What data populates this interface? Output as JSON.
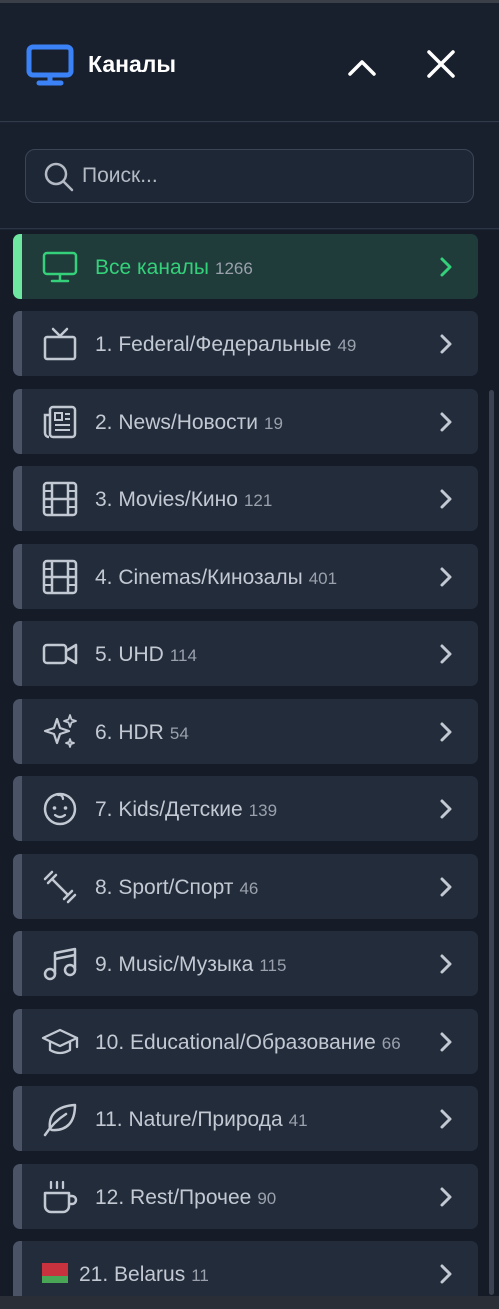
{
  "header": {
    "title": "Каналы",
    "icon": "tv-monitor-icon",
    "collapse_icon": "chevron-up-icon",
    "close_icon": "close-icon"
  },
  "search": {
    "placeholder": "Поиск...",
    "value": ""
  },
  "colors": {
    "accent_green": "#34d17a",
    "active_bar": "#6ee7a0",
    "title_blue": "#3b82f6"
  },
  "categories": [
    {
      "label": "Все каналы",
      "count": "1266",
      "icon": "tv-monitor-icon",
      "active": true
    },
    {
      "label": "1. Federal/Федеральные",
      "count": "49",
      "icon": "tv-antenna-icon"
    },
    {
      "label": "2. News/Новости",
      "count": "19",
      "icon": "newspaper-icon"
    },
    {
      "label": "3. Movies/Кино",
      "count": "121",
      "icon": "film-icon"
    },
    {
      "label": "4. Cinemas/Кинозалы",
      "count": "401",
      "icon": "film-icon"
    },
    {
      "label": "5. UHD",
      "count": "114",
      "icon": "video-camera-icon"
    },
    {
      "label": "6. HDR",
      "count": "54",
      "icon": "sparkles-icon"
    },
    {
      "label": "7. Kids/Детские",
      "count": "139",
      "icon": "baby-face-icon"
    },
    {
      "label": "8. Sport/Спорт",
      "count": "46",
      "icon": "dumbbell-icon"
    },
    {
      "label": "9. Music/Музыка",
      "count": "115",
      "icon": "music-note-icon"
    },
    {
      "label": "10. Educational/Образование",
      "count": "66",
      "icon": "graduation-cap-icon"
    },
    {
      "label": "11. Nature/Природа",
      "count": "41",
      "icon": "leaf-icon"
    },
    {
      "label": "12. Rest/Прочее",
      "count": "90",
      "icon": "coffee-cup-icon"
    },
    {
      "label": "21. Belarus",
      "count": "11",
      "icon": "belarus-flag-icon"
    }
  ]
}
